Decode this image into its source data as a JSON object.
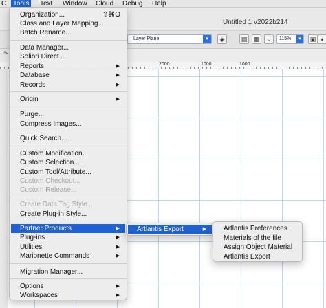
{
  "menubar": {
    "items": [
      "C",
      "Tools",
      "Text",
      "Window",
      "Cloud",
      "Debug",
      "Help"
    ]
  },
  "window": {
    "title": "Untitled 1 v2022b214"
  },
  "toolbar": {
    "layer_select": "Layer Plane",
    "zoom": "115%",
    "icons": [
      "plane-icon",
      "grid-icon",
      "layer-icon",
      "zoom-icon"
    ]
  },
  "ruler": {
    "labels": [
      "2000",
      "1000",
      "1000"
    ]
  },
  "left_strip_label": "Se",
  "tools_menu": {
    "items": [
      {
        "label": "Organization...",
        "shortcut": "⇧⌘O"
      },
      {
        "label": "Class and Layer Mapping..."
      },
      {
        "label": "Batch Rename..."
      },
      {
        "label": "Data Manager..."
      },
      {
        "label": "Solibri Direct..."
      },
      {
        "label": "Reports",
        "submenu": true
      },
      {
        "label": "Database",
        "submenu": true
      },
      {
        "label": "Records",
        "submenu": true
      },
      {
        "label": "Origin",
        "submenu": true
      },
      {
        "label": "Purge..."
      },
      {
        "label": "Compress Images..."
      },
      {
        "label": "Quick Search..."
      },
      {
        "label": "Custom Modification..."
      },
      {
        "label": "Custom Selection..."
      },
      {
        "label": "Custom Tool/Attribute..."
      },
      {
        "label": "Custom Checkout...",
        "disabled": true
      },
      {
        "label": "Custom Release...",
        "disabled": true
      },
      {
        "label": "Create Data Tag Style...",
        "disabled": true
      },
      {
        "label": "Create Plug-in Style..."
      },
      {
        "label": "Partner Products",
        "submenu": true,
        "highlighted": true
      },
      {
        "label": "Plug-ins",
        "submenu": true
      },
      {
        "label": "Utilities",
        "submenu": true
      },
      {
        "label": "Marionette Commands",
        "submenu": true
      },
      {
        "label": "Migration Manager..."
      },
      {
        "label": "Options",
        "submenu": true
      },
      {
        "label": "Workspaces",
        "submenu": true
      }
    ]
  },
  "partner_submenu": {
    "items": [
      {
        "label": "Artlantis Export",
        "submenu": true,
        "highlighted": true
      }
    ]
  },
  "artlantis_submenu": {
    "items": [
      {
        "label": "Artlantis Preferences"
      },
      {
        "label": "Materials of the file"
      },
      {
        "label": "Assign Object Material"
      },
      {
        "label": "Artlantis Export"
      }
    ]
  },
  "colors": {
    "highlight": "#1f62d4",
    "grid": "#bcd8ef"
  }
}
